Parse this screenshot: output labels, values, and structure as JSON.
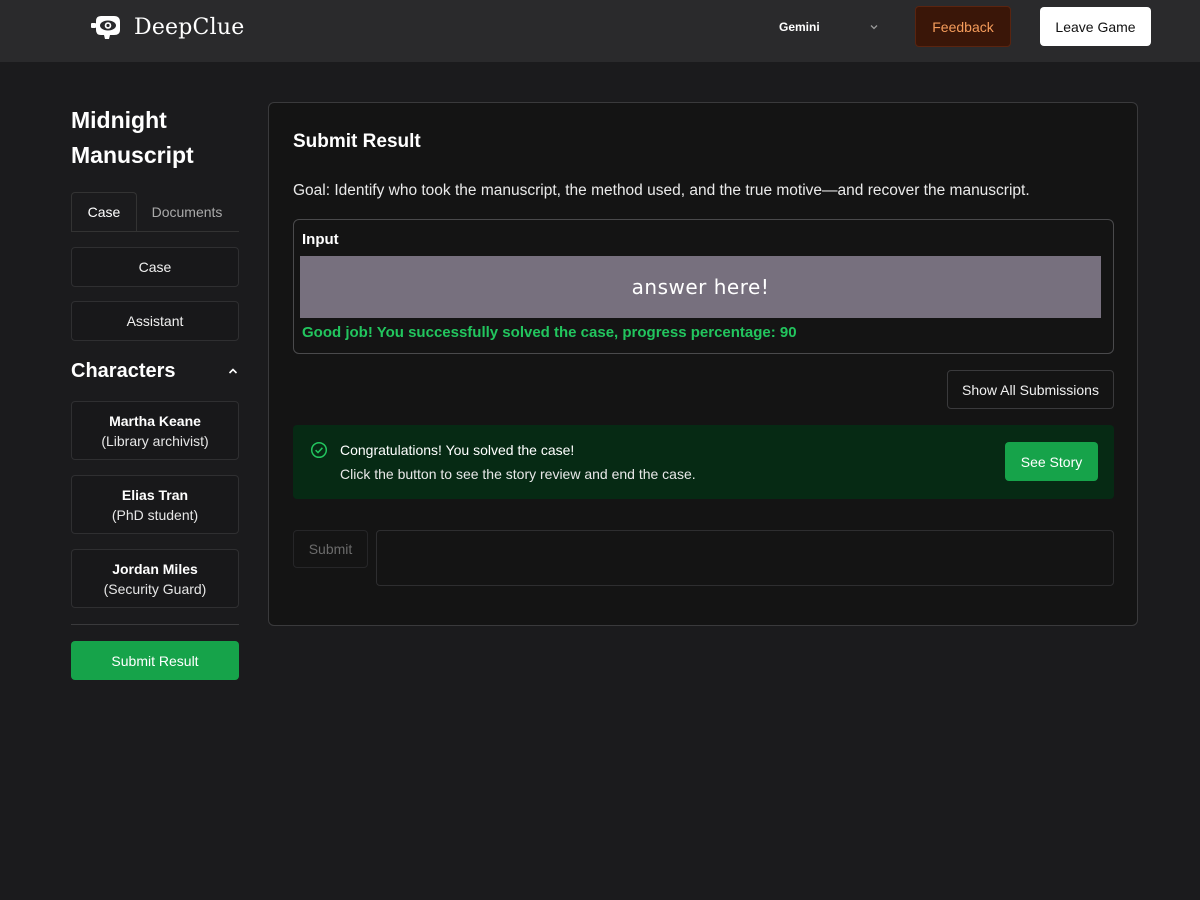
{
  "header": {
    "logo_text": "DeepClue",
    "model_select": "Gemini",
    "feedback_label": "Feedback",
    "leave_label": "Leave Game",
    "colors": {
      "bar": "#2a2a2c",
      "feedback_text": "#f59c5b",
      "feedback_bg": "#3a1608"
    }
  },
  "sidebar": {
    "case_title": "Midnight Manuscript",
    "tabs": [
      {
        "label": "Case",
        "active": true
      },
      {
        "label": "Documents",
        "active": false
      }
    ],
    "buttons": [
      {
        "label": "Case"
      },
      {
        "label": "Assistant"
      }
    ],
    "characters_heading": "Characters",
    "characters": [
      {
        "name": "Martha Keane",
        "role": "(Library archivist)"
      },
      {
        "name": "Elias Tran",
        "role": "(PhD student)"
      },
      {
        "name": "Jordan Miles",
        "role": "(Security Guard)"
      }
    ],
    "submit_result_label": "Submit Result"
  },
  "main": {
    "title": "Submit Result",
    "goal": "Goal: Identify who took the manuscript, the method used, and the true motive—and recover the manuscript.",
    "input_label": "Input",
    "answer_placeholder": "answer here!",
    "success_message": "Good job! You successfully solved the case, progress percentage: 90",
    "progress_percentage": 90,
    "show_all_label": "Show All Submissions",
    "congrats_line1": "Congratulations! You solved the case!",
    "congrats_line2": "Click the button to see the story review and end the case.",
    "see_story_label": "See Story",
    "submit_label": "Submit",
    "submit_text_value": "",
    "colors": {
      "accent_green": "#16a34a",
      "success_text": "#22c55e",
      "congrats_bg": "#062a14"
    }
  }
}
